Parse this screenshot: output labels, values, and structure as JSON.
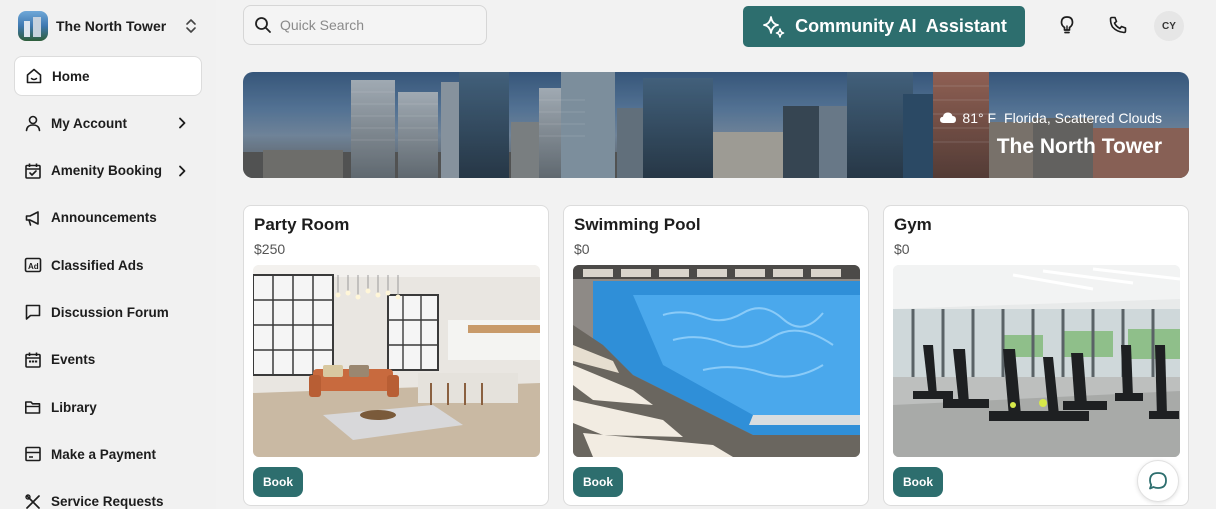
{
  "brand": {
    "name": "The North Tower",
    "logo_icon": "building-logo",
    "switcher_icon": "chevron-up-down-icon"
  },
  "sidebar": {
    "items": [
      {
        "label": "Home",
        "icon": "home-icon",
        "active": true,
        "has_chevron": false
      },
      {
        "label": "My Account",
        "icon": "user-icon",
        "active": false,
        "has_chevron": true
      },
      {
        "label": "Amenity Booking",
        "icon": "calendar-check-icon",
        "active": false,
        "has_chevron": true
      },
      {
        "label": "Announcements",
        "icon": "megaphone-icon",
        "active": false,
        "has_chevron": false
      },
      {
        "label": "Classified Ads",
        "icon": "ad-icon",
        "active": false,
        "has_chevron": false
      },
      {
        "label": "Discussion Forum",
        "icon": "chat-square-icon",
        "active": false,
        "has_chevron": false
      },
      {
        "label": "Events",
        "icon": "calendar-icon",
        "active": false,
        "has_chevron": false
      },
      {
        "label": "Library",
        "icon": "folder-icon",
        "active": false,
        "has_chevron": false
      },
      {
        "label": "Make a Payment",
        "icon": "payment-icon",
        "active": false,
        "has_chevron": false
      },
      {
        "label": "Service Requests",
        "icon": "tools-icon",
        "active": false,
        "has_chevron": false
      }
    ]
  },
  "header": {
    "search_placeholder": "Quick Search",
    "ai_button_label": "Community AI  Assistant",
    "avatar_initials": "CY"
  },
  "hero": {
    "temperature": "81° F",
    "location": "Florida, Scattered Clouds",
    "title": "The North Tower"
  },
  "amenities": [
    {
      "name": "Party Room",
      "price": "$250",
      "button": "Book"
    },
    {
      "name": "Swimming Pool",
      "price": "$0",
      "button": "Book"
    },
    {
      "name": "Gym",
      "price": "$0",
      "button": "Book"
    }
  ],
  "colors": {
    "accent": "#2d6e6e",
    "sidebar_bg": "#f1f1f1",
    "page_bg": "#f2f2f2"
  }
}
